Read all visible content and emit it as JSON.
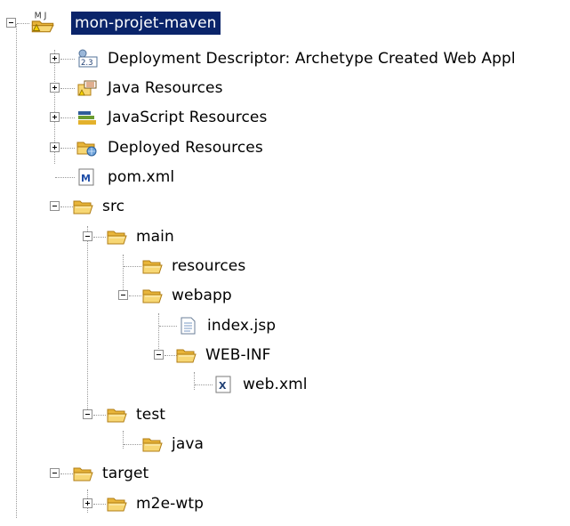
{
  "tree": {
    "project": {
      "label": "mon-projet-maven"
    },
    "deployment_descriptor": {
      "label": "Deployment Descriptor: Archetype Created Web Appl",
      "badge": "2.3"
    },
    "java_resources": {
      "label": "Java Resources"
    },
    "javascript_resources": {
      "label": "JavaScript Resources"
    },
    "deployed_resources": {
      "label": "Deployed Resources"
    },
    "pom": {
      "label": "pom.xml",
      "badge": "M"
    },
    "src": {
      "label": "src"
    },
    "main": {
      "label": "main"
    },
    "resources": {
      "label": "resources"
    },
    "webapp": {
      "label": "webapp"
    },
    "index_jsp": {
      "label": "index.jsp"
    },
    "web_inf": {
      "label": "WEB-INF"
    },
    "web_xml": {
      "label": "web.xml",
      "badge": "X"
    },
    "test": {
      "label": "test"
    },
    "java": {
      "label": "java"
    },
    "target": {
      "label": "target"
    },
    "m2e_wtp": {
      "label": "m2e-wtp"
    },
    "project_badge": "M J"
  },
  "colors": {
    "selection": "#0a246a",
    "folder": "#f2c14e",
    "tree_line": "#9a9a9a"
  }
}
